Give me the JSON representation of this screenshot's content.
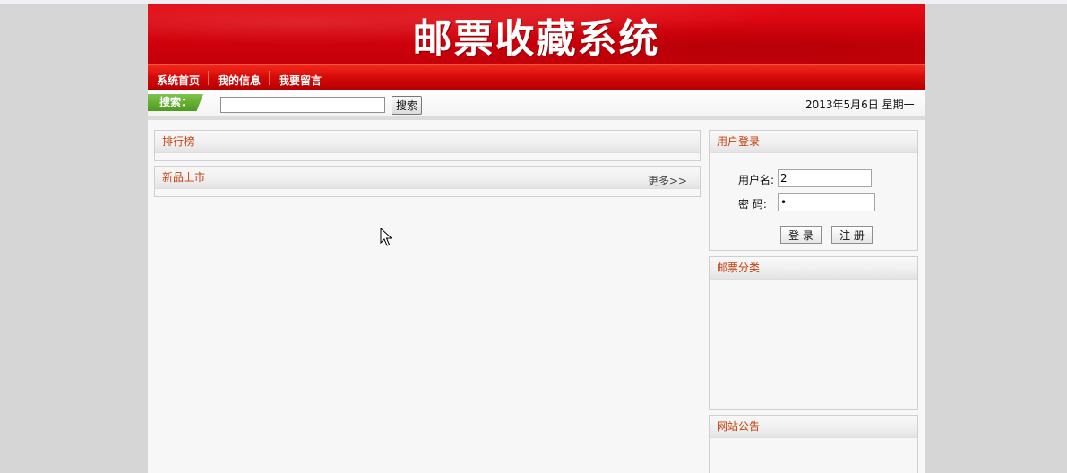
{
  "site": {
    "title": "邮票收藏系统"
  },
  "nav": {
    "items": [
      "系统首页",
      "我的信息",
      "我要留言"
    ]
  },
  "search": {
    "tag_label": "搜索：",
    "input_value": "",
    "button_label": "搜索"
  },
  "date_text": "2013年5月6日 星期一",
  "main": {
    "ranking_title": "排行榜",
    "new_arrivals_title": "新品上市",
    "more_label": "更多>>"
  },
  "login": {
    "title": "用户登录",
    "username_label": "用户名:",
    "username_value": "2",
    "password_label": "密 码:",
    "password_value": "•",
    "login_button": "登 录",
    "register_button": "注 册"
  },
  "categories": {
    "title": "邮票分类"
  },
  "announcements": {
    "title": "网站公告"
  },
  "colors": {
    "banner": "#d2000a",
    "nav": "#d40a08",
    "accent_text": "#c8400e",
    "search_tag": "#4e9a1f"
  }
}
